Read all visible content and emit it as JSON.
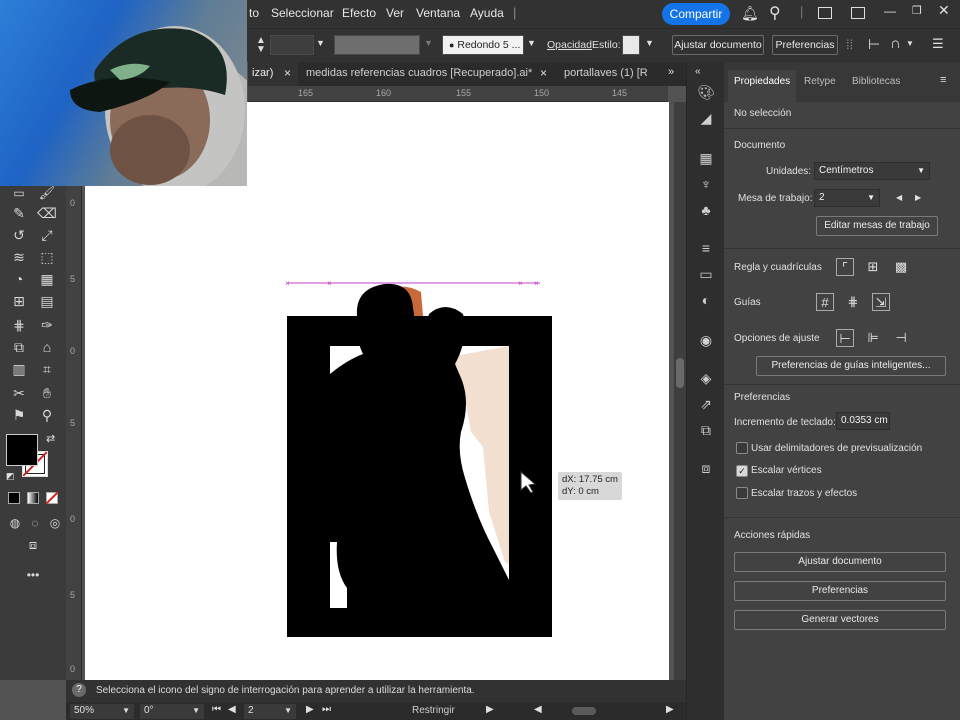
{
  "menubar": {
    "items": [
      "to",
      "Seleccionar",
      "Efecto",
      "Ver",
      "Ventana",
      "Ayuda"
    ],
    "share_label": "Compartir"
  },
  "controlbar": {
    "brush_label": "Redondo 5 ...",
    "opacity_label": "Opacidad",
    "style_label": "Estilo:",
    "adjust_doc_label": "Ajustar documento",
    "prefs_label": "Preferencias"
  },
  "tabs": [
    {
      "label": "izar)",
      "close": "×"
    },
    {
      "label": "medidas referencias cuadros [Recuperado].ai*",
      "close": "×"
    },
    {
      "label": "portallaves (1) [R",
      "close": "×"
    }
  ],
  "ruler_top": [
    "165",
    "160",
    "155",
    "150",
    "145"
  ],
  "ruler_left": [
    "0",
    "5",
    "0",
    "5",
    "0",
    "5",
    "0",
    "5"
  ],
  "tooltip": {
    "dx": "dX: 17.75 cm",
    "dy": "dY: 0 cm"
  },
  "status": {
    "help_icon": "?",
    "message": "Selecciona el icono del signo de interrogación para aprender a utilizar la herramienta."
  },
  "bottom": {
    "zoom": "50%",
    "rotation": "0°",
    "artboard": "2",
    "restrict": "Restringir"
  },
  "panel": {
    "tabs": [
      "Propiedades",
      "Retype",
      "Bibliotecas"
    ],
    "no_selection": "No selección",
    "document_title": "Documento",
    "units_label": "Unidades:",
    "units_value": "Centímetros",
    "artboard_label": "Mesa de trabajo:",
    "artboard_value": "2",
    "edit_artboards": "Editar mesas de trabajo",
    "rulers_grids": "Regla y cuadrículas",
    "guides": "Guías",
    "snap_options": "Opciones de ajuste",
    "smart_guides_prefs": "Preferencias de guías inteligentes...",
    "prefs_title": "Preferencias",
    "keyboard_inc_label": "Incremento de teclado:",
    "keyboard_inc_value": "0.0353 cm",
    "chk_preview": "Usar delimitadores de previsualización",
    "chk_corners": "Escalar vértices",
    "chk_strokes": "Escalar trazos y efectos",
    "quick_actions": "Acciones rápidas",
    "btn_adjust": "Ajustar documento",
    "btn_prefs": "Preferencias",
    "btn_vectors": "Generar vectores"
  },
  "colors": {
    "accent": "#1473e6",
    "guide": "#c03cc8",
    "panel_bg": "#424242",
    "app_bg": "#323232"
  },
  "checkbox_state": {
    "preview": false,
    "corners": true,
    "strokes": false
  }
}
